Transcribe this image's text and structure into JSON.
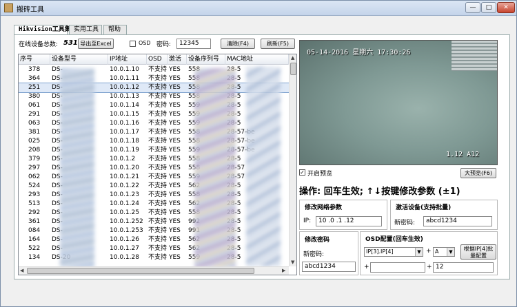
{
  "window": {
    "title": "搬砖工具"
  },
  "tabs": [
    {
      "label": "Hikvision工具集"
    },
    {
      "label": "实用工具"
    },
    {
      "label": "帮助"
    }
  ],
  "toolbar": {
    "online_label": "在线设备总数:",
    "online_count": "531",
    "export_label": "导出至Excel",
    "osd_label": "OSD",
    "password_label": "密码:",
    "password_value": "12345",
    "clear_label": "清除(F4)",
    "refresh_label": "刷新(F5)"
  },
  "table": {
    "columns": [
      "序号",
      "设备型号",
      "IP地址",
      "OSD",
      "激活",
      "设备序列号",
      "MAC地址"
    ],
    "rows": [
      {
        "no": "378",
        "model": "DS-",
        "ip": "10.0.1.10",
        "osd": "不支持",
        "act": "YES",
        "serial": "558",
        "mac": "28-5"
      },
      {
        "no": "364",
        "model": "DS-",
        "ip": "10.0.1.11",
        "osd": "不支持",
        "act": "YES",
        "serial": "558",
        "mac": "28-5"
      },
      {
        "no": "251",
        "model": "DS-",
        "ip": "10.0.1.12",
        "osd": "不支持",
        "act": "YES",
        "serial": "558",
        "mac": "28-5"
      },
      {
        "no": "380",
        "model": "DS-",
        "ip": "10.0.1.13",
        "osd": "不支持",
        "act": "YES",
        "serial": "558",
        "mac": "28-5"
      },
      {
        "no": "061",
        "model": "DS-",
        "ip": "10.0.1.14",
        "osd": "不支持",
        "act": "YES",
        "serial": "559",
        "mac": "28-5"
      },
      {
        "no": "291",
        "model": "DS-",
        "ip": "10.0.1.15",
        "osd": "不支持",
        "act": "YES",
        "serial": "559",
        "mac": "28-5"
      },
      {
        "no": "063",
        "model": "DS-",
        "ip": "10.0.1.16",
        "osd": "不支持",
        "act": "YES",
        "serial": "559",
        "mac": "28-5"
      },
      {
        "no": "381",
        "model": "DS-",
        "ip": "10.0.1.17",
        "osd": "不支持",
        "act": "YES",
        "serial": "558",
        "mac": "28-57-be"
      },
      {
        "no": "025",
        "model": "DS-",
        "ip": "10.0.1.18",
        "osd": "不支持",
        "act": "YES",
        "serial": "558",
        "mac": "28-57-be"
      },
      {
        "no": "208",
        "model": "DS-",
        "ip": "10.0.1.19",
        "osd": "不支持",
        "act": "YES",
        "serial": "559",
        "mac": "28-57-be"
      },
      {
        "no": "379",
        "model": "DS-",
        "ip": "10.0.1.2",
        "osd": "不支持",
        "act": "YES",
        "serial": "558",
        "mac": "28-5"
      },
      {
        "no": "297",
        "model": "DS-",
        "ip": "10.0.1.20",
        "osd": "不支持",
        "act": "YES",
        "serial": "558",
        "mac": "28-57"
      },
      {
        "no": "062",
        "model": "DS-",
        "ip": "10.0.1.21",
        "osd": "不支持",
        "act": "YES",
        "serial": "559",
        "mac": "28-57"
      },
      {
        "no": "524",
        "model": "DS-",
        "ip": "10.0.1.22",
        "osd": "不支持",
        "act": "YES",
        "serial": "562",
        "mac": "28-5"
      },
      {
        "no": "293",
        "model": "DS-",
        "ip": "10.0.1.23",
        "osd": "不支持",
        "act": "YES",
        "serial": "558",
        "mac": "28-5"
      },
      {
        "no": "513",
        "model": "DS-",
        "ip": "10.0.1.24",
        "osd": "不支持",
        "act": "YES",
        "serial": "562",
        "mac": "28-5"
      },
      {
        "no": "292",
        "model": "DS-",
        "ip": "10.0.1.25",
        "osd": "不支持",
        "act": "YES",
        "serial": "558",
        "mac": "28-5"
      },
      {
        "no": "361",
        "model": "DS-",
        "ip": "10.0.1.252",
        "osd": "不支持",
        "act": "YES",
        "serial": "992",
        "mac": "28-5"
      },
      {
        "no": "084",
        "model": "DS-",
        "ip": "10.0.1.253",
        "osd": "不支持",
        "act": "YES",
        "serial": "991",
        "mac": "28-5"
      },
      {
        "no": "164",
        "model": "DS-",
        "ip": "10.0.1.26",
        "osd": "不支持",
        "act": "YES",
        "serial": "562",
        "mac": "28-5"
      },
      {
        "no": "522",
        "model": "DS-",
        "ip": "10.0.1.27",
        "osd": "不支持",
        "act": "YES",
        "serial": "562",
        "mac": "28-5"
      },
      {
        "no": "134",
        "model": "DS-20",
        "ip": "10.0.1.28",
        "osd": "不支持",
        "act": "YES",
        "serial": "559",
        "mac": "28-5"
      }
    ]
  },
  "preview": {
    "timestamp": "05-14-2016 星期六 17:30:26",
    "camera_name": "1.12 A12",
    "enable_label": "开启预览",
    "big_preview_label": "大预览(F6)"
  },
  "hint": "操作: 回车生效; ↑↓按键修改参数 (±1)",
  "network": {
    "title": "修改网络参数",
    "ip_label": "IP:",
    "ip_value": "10 .0 .1 .12"
  },
  "activate": {
    "title": "激活设备(支持批量)",
    "new_pwd_label": "新密码:",
    "new_pwd_value": "abcd1234"
  },
  "change_pwd": {
    "title": "修改密码",
    "new_pwd_label": "新密码:",
    "new_pwd_value": "abcd1234"
  },
  "osd_config": {
    "title": "OSD配置(回车生效)",
    "select1": "IP[3].IP[4]",
    "plus1": "+",
    "select2": "A",
    "plus2": "+",
    "plus3": "+",
    "plus4": "+",
    "value4": "12",
    "button_label": "根据IP[4]批量配置"
  }
}
